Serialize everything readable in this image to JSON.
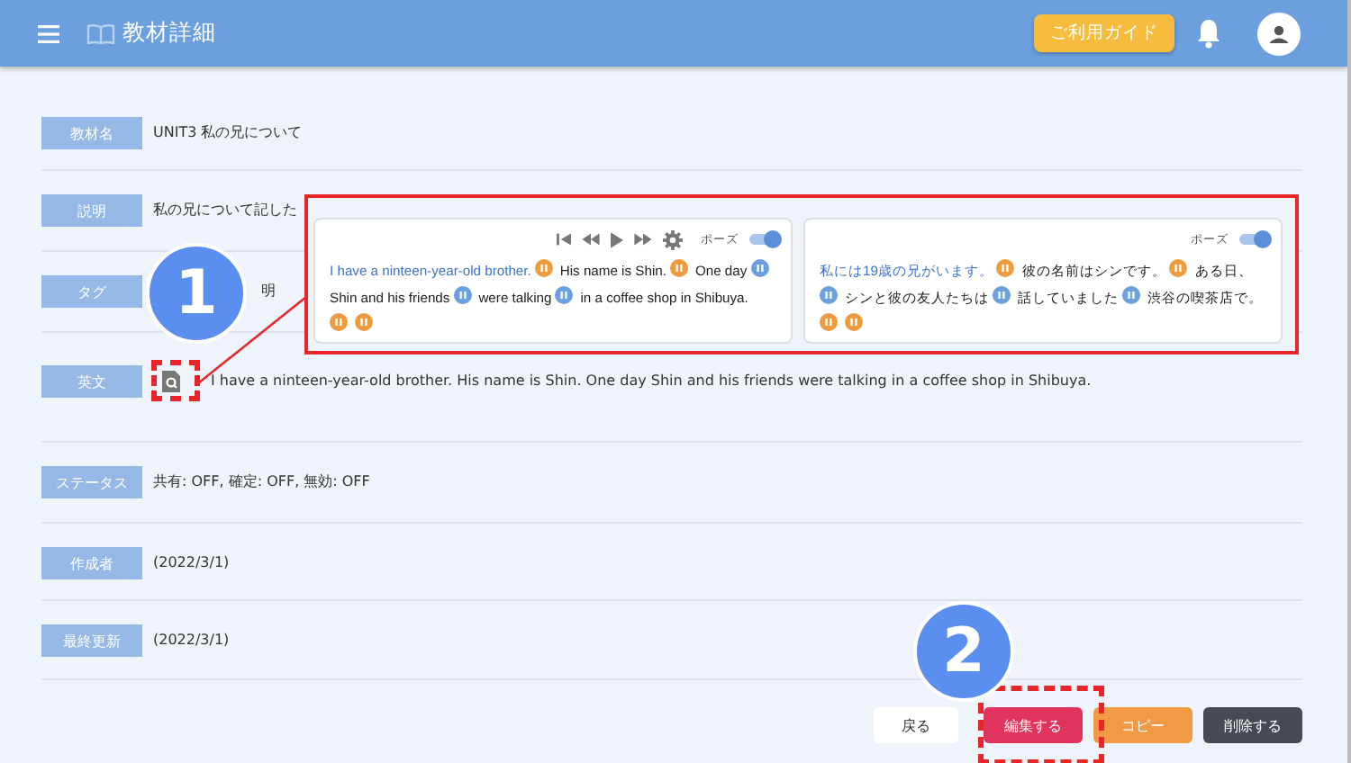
{
  "header": {
    "title": "教材詳細",
    "guide_button": "ご利用ガイド"
  },
  "fields": [
    {
      "label": "教材名",
      "value": "UNIT3 私の兄について"
    },
    {
      "label": "説明",
      "value": "私の兄について記した"
    },
    {
      "label": "タグ",
      "value": "明"
    },
    {
      "label": "英文",
      "value": "I have a ninteen-year-old brother. His name is Shin. One day Shin and his friends were talking in a coffee shop in Shibuya.",
      "preview_icon": true
    },
    {
      "label": "ステータス",
      "value": "共有: OFF, 確定: OFF, 無効: OFF"
    },
    {
      "label": "作成者",
      "value": "(2022/3/1)"
    },
    {
      "label": "最終更新",
      "value": "(2022/3/1)"
    }
  ],
  "popup": {
    "panels": [
      {
        "player_controls": true,
        "toggle_label": "ポーズ",
        "toggle_on": true,
        "segments": [
          {
            "kind": "text",
            "text": "I have a ninteen-year-old brother.",
            "highlighted": true
          },
          {
            "kind": "pause",
            "color": "#ee9a3e"
          },
          {
            "kind": "text",
            "text": "His name is Shin.",
            "highlighted": false
          },
          {
            "kind": "pause",
            "color": "#ee9a3e"
          },
          {
            "kind": "text",
            "text": "One day",
            "highlighted": false
          },
          {
            "kind": "pause",
            "color": "#6c9fdd"
          },
          {
            "kind": "text",
            "text": "Shin and his friends",
            "highlighted": false
          },
          {
            "kind": "pause",
            "color": "#6c9fdd"
          },
          {
            "kind": "text",
            "text": "were talking",
            "highlighted": false
          },
          {
            "kind": "pause",
            "color": "#6c9fdd"
          },
          {
            "kind": "text",
            "text": "in a coffee shop in Shibuya.",
            "highlighted": false
          },
          {
            "kind": "pause",
            "color": "#ee9a3e"
          },
          {
            "kind": "pause",
            "color": "#ee9a3e"
          }
        ]
      },
      {
        "player_controls": false,
        "toggle_label": "ポーズ",
        "toggle_on": true,
        "segments": [
          {
            "kind": "text",
            "text": "私には19歳の兄がいます。",
            "highlighted": true
          },
          {
            "kind": "pause",
            "color": "#ee9a3e"
          },
          {
            "kind": "text",
            "text": "彼の名前はシンです。",
            "highlighted": false
          },
          {
            "kind": "pause",
            "color": "#ee9a3e"
          },
          {
            "kind": "text",
            "text": "ある日、",
            "highlighted": false
          },
          {
            "kind": "pause",
            "color": "#6c9fdd"
          },
          {
            "kind": "text",
            "text": "シンと彼の友人たちは",
            "highlighted": false
          },
          {
            "kind": "pause",
            "color": "#6c9fdd"
          },
          {
            "kind": "text",
            "text": "話していました",
            "highlighted": false
          },
          {
            "kind": "pause",
            "color": "#6c9fdd"
          },
          {
            "kind": "text",
            "text": "渋谷の喫茶店で。",
            "highlighted": false
          },
          {
            "kind": "pause",
            "color": "#ee9a3e"
          },
          {
            "kind": "pause",
            "color": "#ee9a3e"
          }
        ]
      }
    ]
  },
  "buttons": [
    {
      "kind": "back",
      "label": "戻る"
    },
    {
      "kind": "edit",
      "label": "編集する"
    },
    {
      "kind": "copy",
      "label": "コピー"
    },
    {
      "kind": "delete",
      "label": "削除する"
    }
  ],
  "callouts": [
    {
      "number": "1"
    },
    {
      "number": "2"
    }
  ]
}
